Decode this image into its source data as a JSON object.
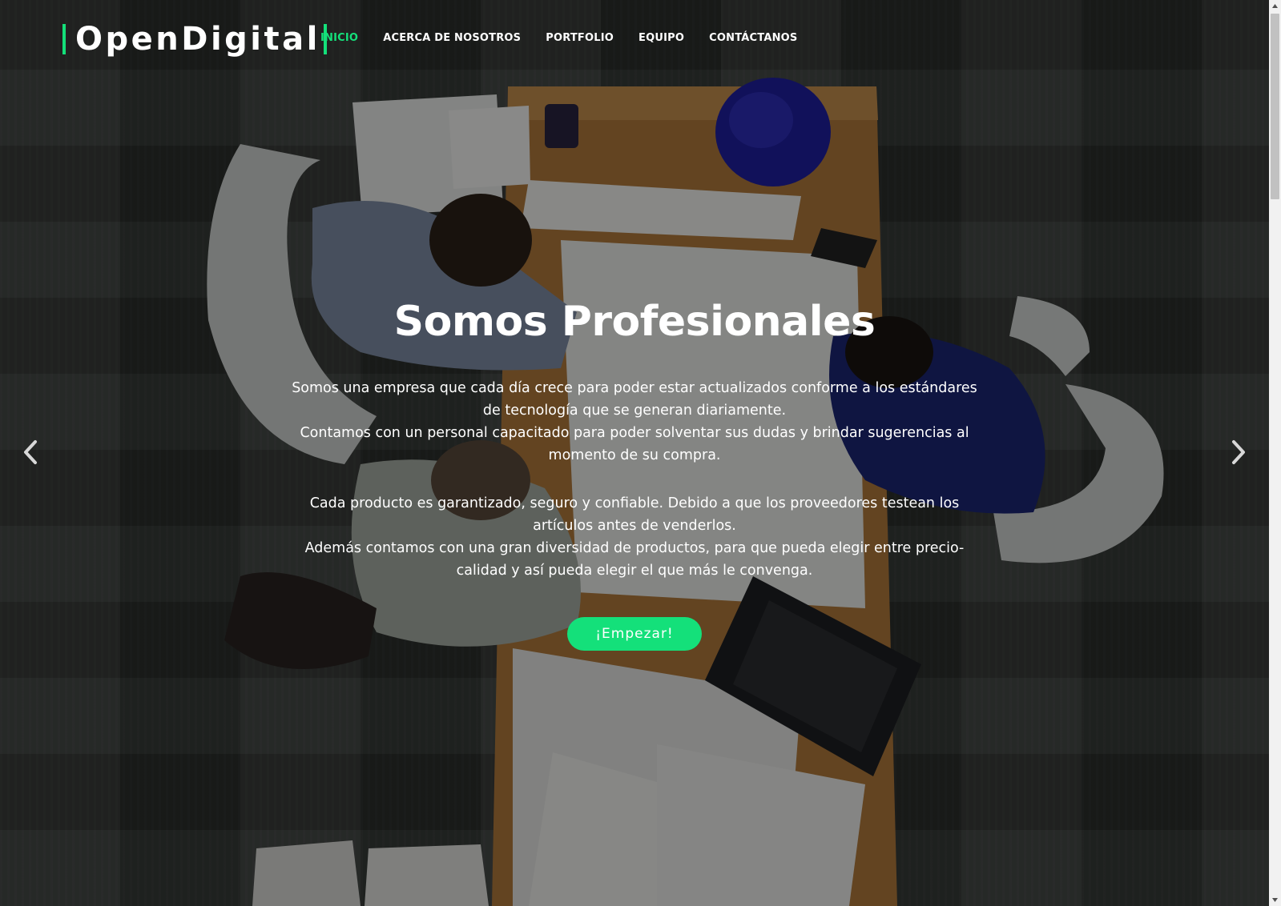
{
  "brand": {
    "name": "OpenDigital",
    "accent_color": "#14e07a"
  },
  "nav": {
    "items": [
      {
        "label": "INICIO",
        "active": true
      },
      {
        "label": "ACERCA DE NOSOTROS",
        "active": false
      },
      {
        "label": "PORTFOLIO",
        "active": false
      },
      {
        "label": "EQUIPO",
        "active": false
      },
      {
        "label": "CONTÁCTANOS",
        "active": false
      }
    ]
  },
  "hero": {
    "title": "Somos Profesionales",
    "paragraph_1": [
      "Somos una empresa que cada día crece para poder estar actualizados conforme a los estándares de tecnología que se generan diariamente.",
      "Contamos con un personal capacitado para poder solventar sus dudas y brindar sugerencias al momento de su compra."
    ],
    "paragraph_2": [
      "Cada producto es garantizado, seguro y confiable. Debido a que los proveedores testean los artículos antes de venderlos.",
      "Además contamos con una gran diversidad de productos, para que pueda elegir entre precio-calidad y así pueda elegir el que más le convenga."
    ],
    "cta_label": "¡Empezar!",
    "prev_icon": "chevron-left-icon",
    "next_icon": "chevron-right-icon"
  }
}
